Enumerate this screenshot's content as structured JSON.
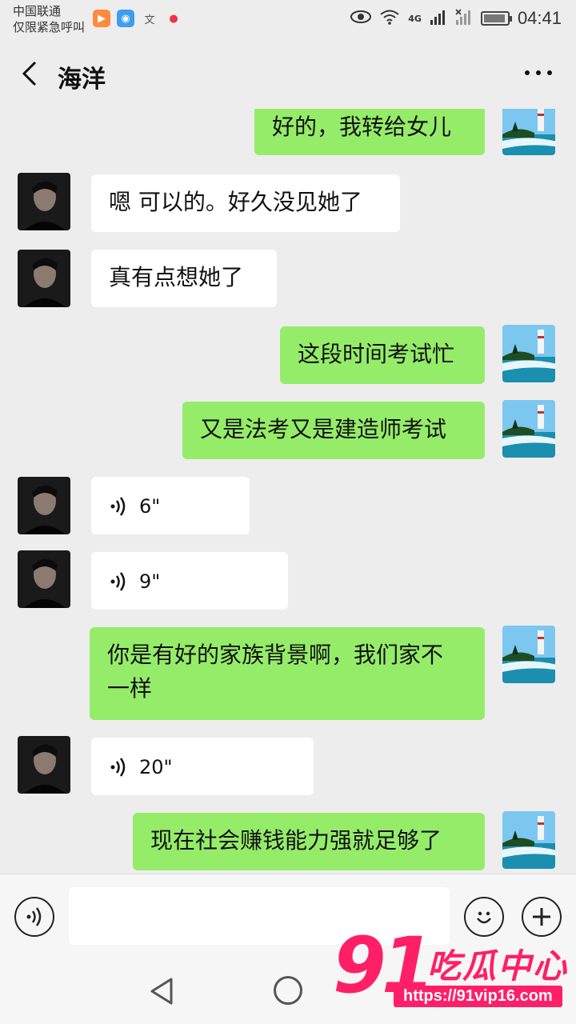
{
  "status_bar": {
    "carrier_line1": "中国联通",
    "carrier_line2": "仅限紧急呼叫",
    "network": "4G",
    "time": "04:41"
  },
  "header": {
    "title": "海洋"
  },
  "messages": [
    {
      "side": "me",
      "text": "好的，我转给女儿"
    },
    {
      "side": "them",
      "text": "嗯 可以的。好久没见她了"
    },
    {
      "side": "them",
      "text": "真有点想她了"
    },
    {
      "side": "me",
      "text": "这段时间考试忙"
    },
    {
      "side": "me",
      "text": "又是法考又是建造师考试"
    },
    {
      "side": "them",
      "voice": true,
      "duration": "6\""
    },
    {
      "side": "them",
      "voice": true,
      "duration": "9\""
    },
    {
      "side": "me",
      "text_line1": "你是有好的家族背景啊，我们家不",
      "text_line2": "一样"
    },
    {
      "side": "them",
      "voice": true,
      "duration": "20\""
    },
    {
      "side": "me",
      "text": "现在社会赚钱能力强就足够了"
    }
  ],
  "watermark": {
    "number": "91",
    "name": "吃瓜中心",
    "url": "https://91vip16.com"
  },
  "colors": {
    "my_bubble": "#95ec69",
    "their_bubble": "#ffffff",
    "background": "#ededed",
    "watermark": "#ff1f66"
  }
}
